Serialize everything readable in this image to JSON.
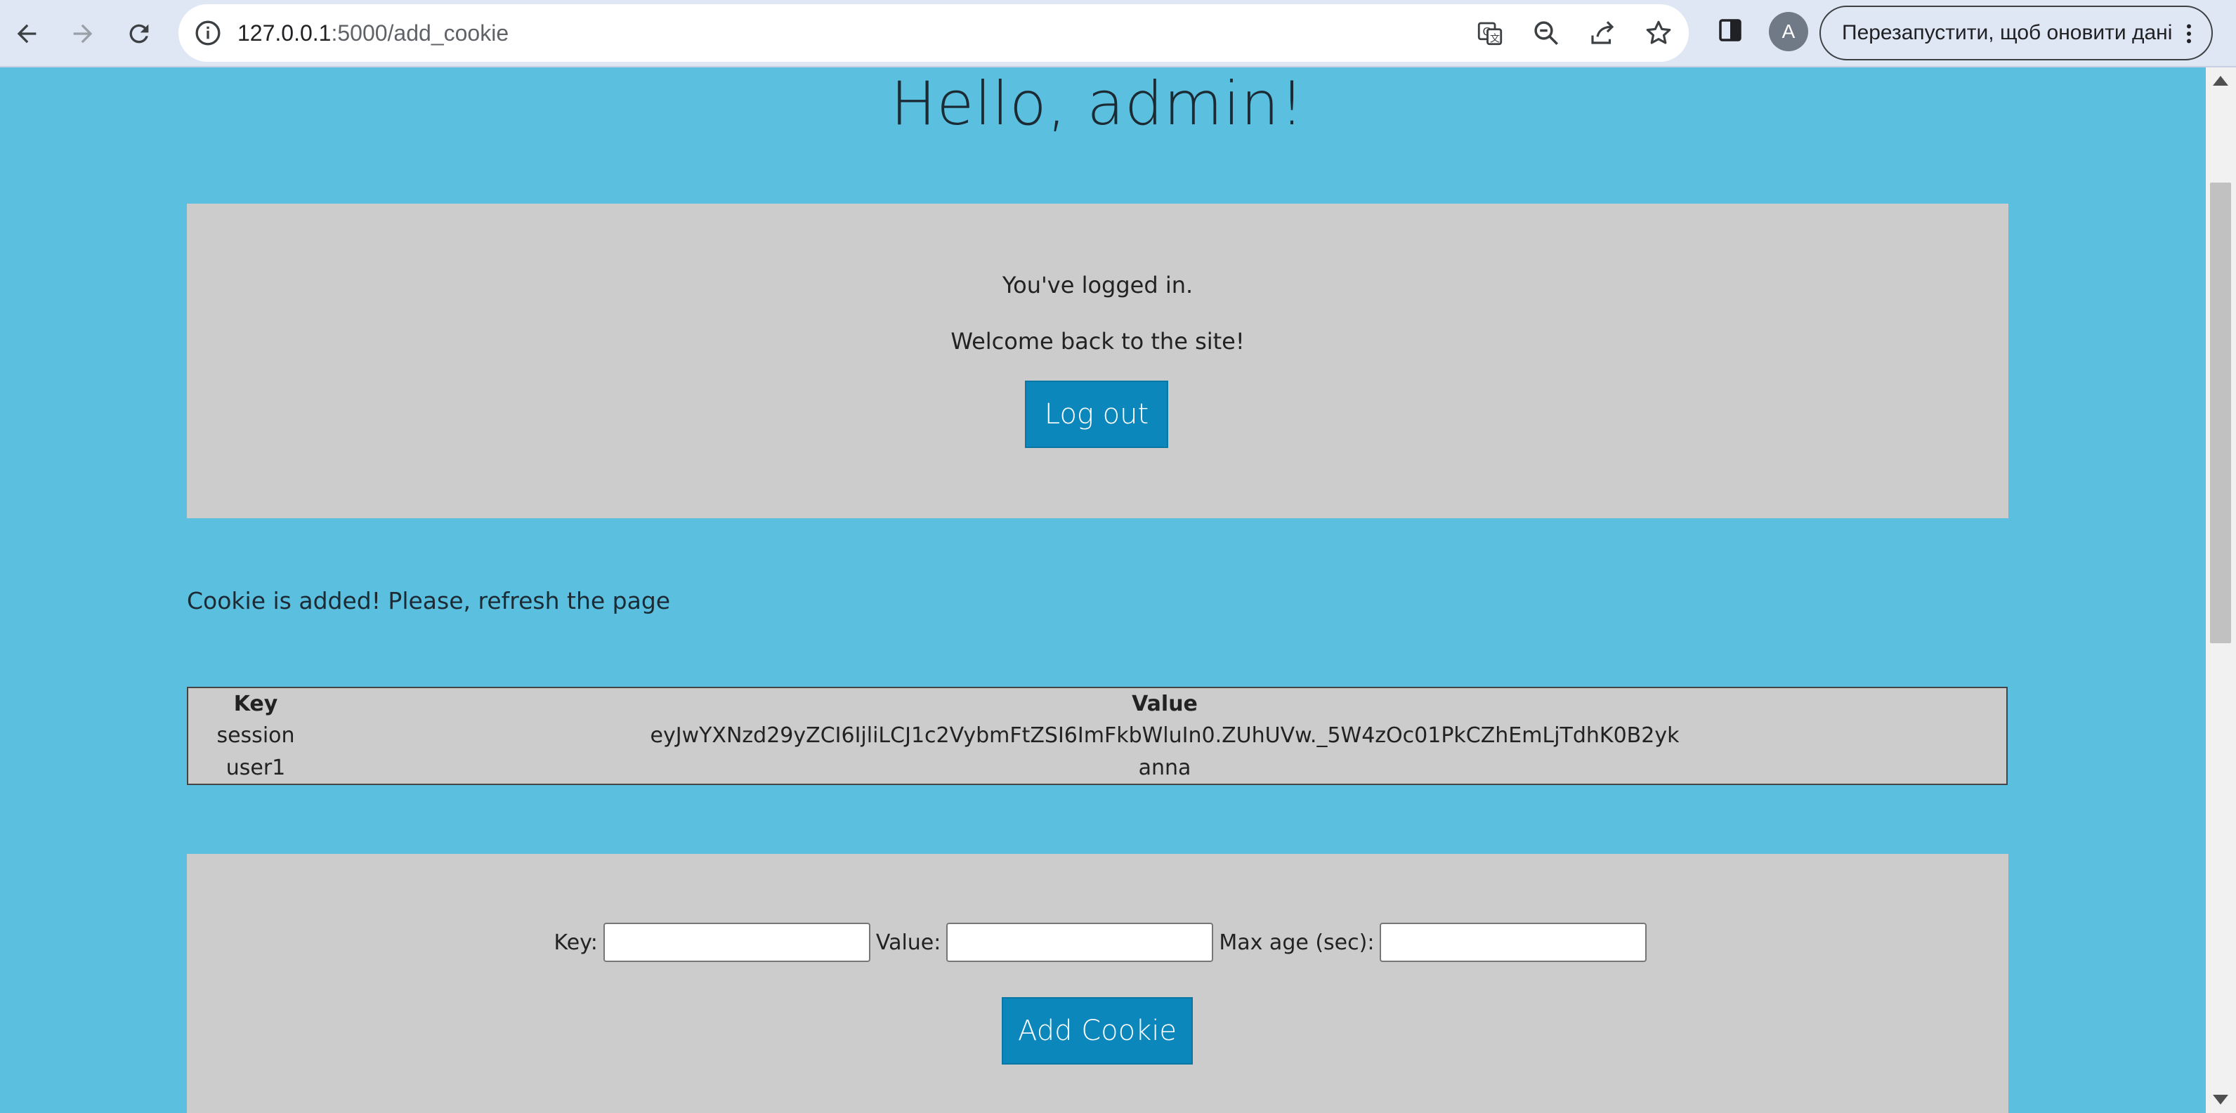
{
  "browser": {
    "url_host": "127.0.0.1",
    "url_path": ":5000/add_cookie",
    "profile_initial": "A",
    "relaunch_label": "Перезапустити, щоб оновити дані"
  },
  "page": {
    "title": "Hello, admin!",
    "login_message": "You've logged in.",
    "welcome_message": "Welcome back to the site!",
    "logout_label": "Log out",
    "status_message": "Cookie is added! Please, refresh the page"
  },
  "cookies": {
    "headers": {
      "key": "Key",
      "value": "Value"
    },
    "rows": [
      {
        "key": "session",
        "value": "eyJwYXNzd29yZCI6IjliLCJ1c2VybmFtZSI6ImFkbWluIn0.ZUhUVw._5W4zOc01PkCZhEmLjTdhK0B2yk"
      },
      {
        "key": "user1",
        "value": "anna"
      }
    ]
  },
  "form": {
    "key_label": "Key:",
    "value_label": "Value:",
    "max_age_label": "Max age (sec):",
    "key_value": "",
    "value_value": "",
    "max_age_value": "",
    "submit_label": "Add Cookie"
  },
  "colors": {
    "page_background": "#5bbfdf",
    "panel_background": "#cccccc",
    "button_background": "#0b87bb"
  }
}
